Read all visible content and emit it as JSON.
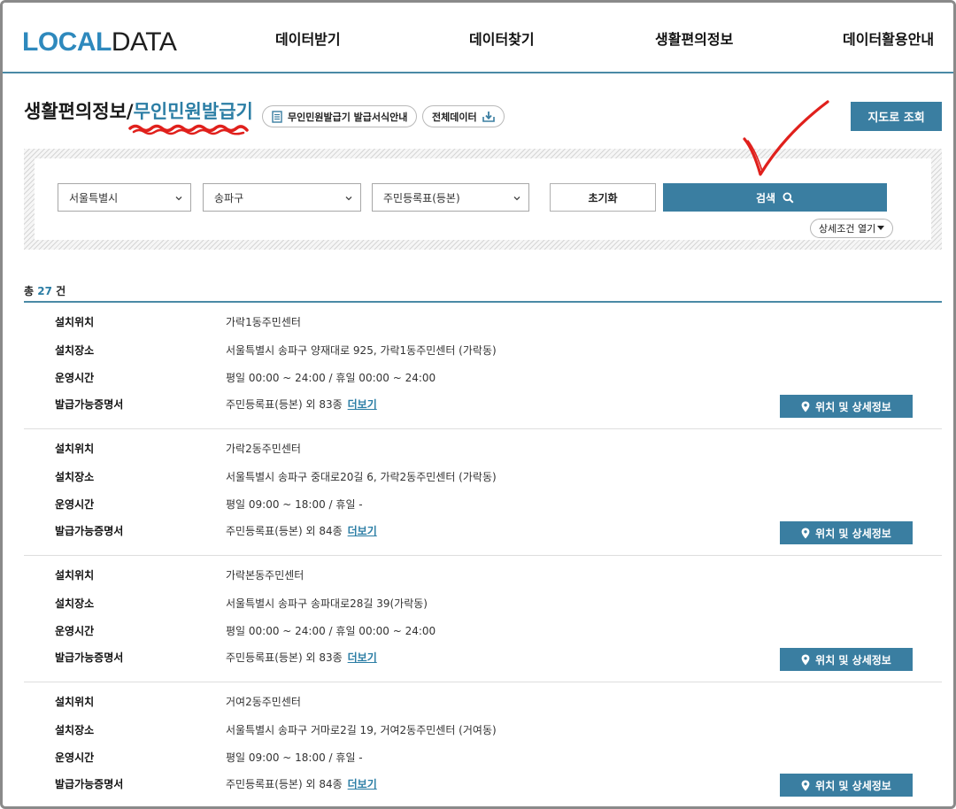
{
  "header": {
    "logo_part1": "LOCAL",
    "logo_part2": "DATA",
    "nav": [
      "데이터받기",
      "데이터찾기",
      "생활편의정보",
      "데이터활용안내"
    ]
  },
  "title": {
    "main": "생활편의정보/",
    "sub": "무인민원발급기",
    "pill_guide": "무인민원발급기 발급서식안내",
    "pill_all_data": "전체데이터",
    "map_button": "지도로 조회"
  },
  "search": {
    "city": "서울특별시",
    "district": "송파구",
    "document": "주민등록표(등본)",
    "reset_label": "초기화",
    "search_label": "검색",
    "detail_toggle": "상세조건 열기"
  },
  "results": {
    "total_prefix": "총",
    "total_count": "27",
    "total_suffix": "건",
    "labels": {
      "location": "설치위치",
      "place": "설치장소",
      "hours": "운영시간",
      "certs": "발급가능증명서"
    },
    "more_label": "더보기",
    "detail_button": "위치 및 상세정보",
    "items": [
      {
        "location": "가락1동주민센터",
        "place": "서울특별시 송파구 양재대로 925, 가락1동주민센터 (가락동)",
        "hours": "평일 00:00 ~ 24:00 / 휴일 00:00 ~ 24:00",
        "certs": "주민등록표(등본) 외 83종"
      },
      {
        "location": "가락2동주민센터",
        "place": "서울특별시 송파구 중대로20길 6, 가락2동주민센터 (가락동)",
        "hours": "평일 09:00 ~ 18:00 / 휴일 -",
        "certs": "주민등록표(등본) 외 84종"
      },
      {
        "location": "가락본동주민센터",
        "place": "서울특별시 송파구 송파대로28길 39(가락동)",
        "hours": "평일 00:00 ~ 24:00 / 휴일 00:00 ~ 24:00",
        "certs": "주민등록표(등본) 외 83종"
      },
      {
        "location": "거여2동주민센터",
        "place": "서울특별시 송파구 거마로2길 19, 거여2동주민센터 (거여동)",
        "hours": "평일 09:00 ~ 18:00 / 휴일 -",
        "certs": "주민등록표(등본) 외 84종"
      }
    ]
  },
  "colors": {
    "accent": "#3a7ea1",
    "logo_blue": "#2e89bd",
    "annotation_red": "#e0201c"
  }
}
